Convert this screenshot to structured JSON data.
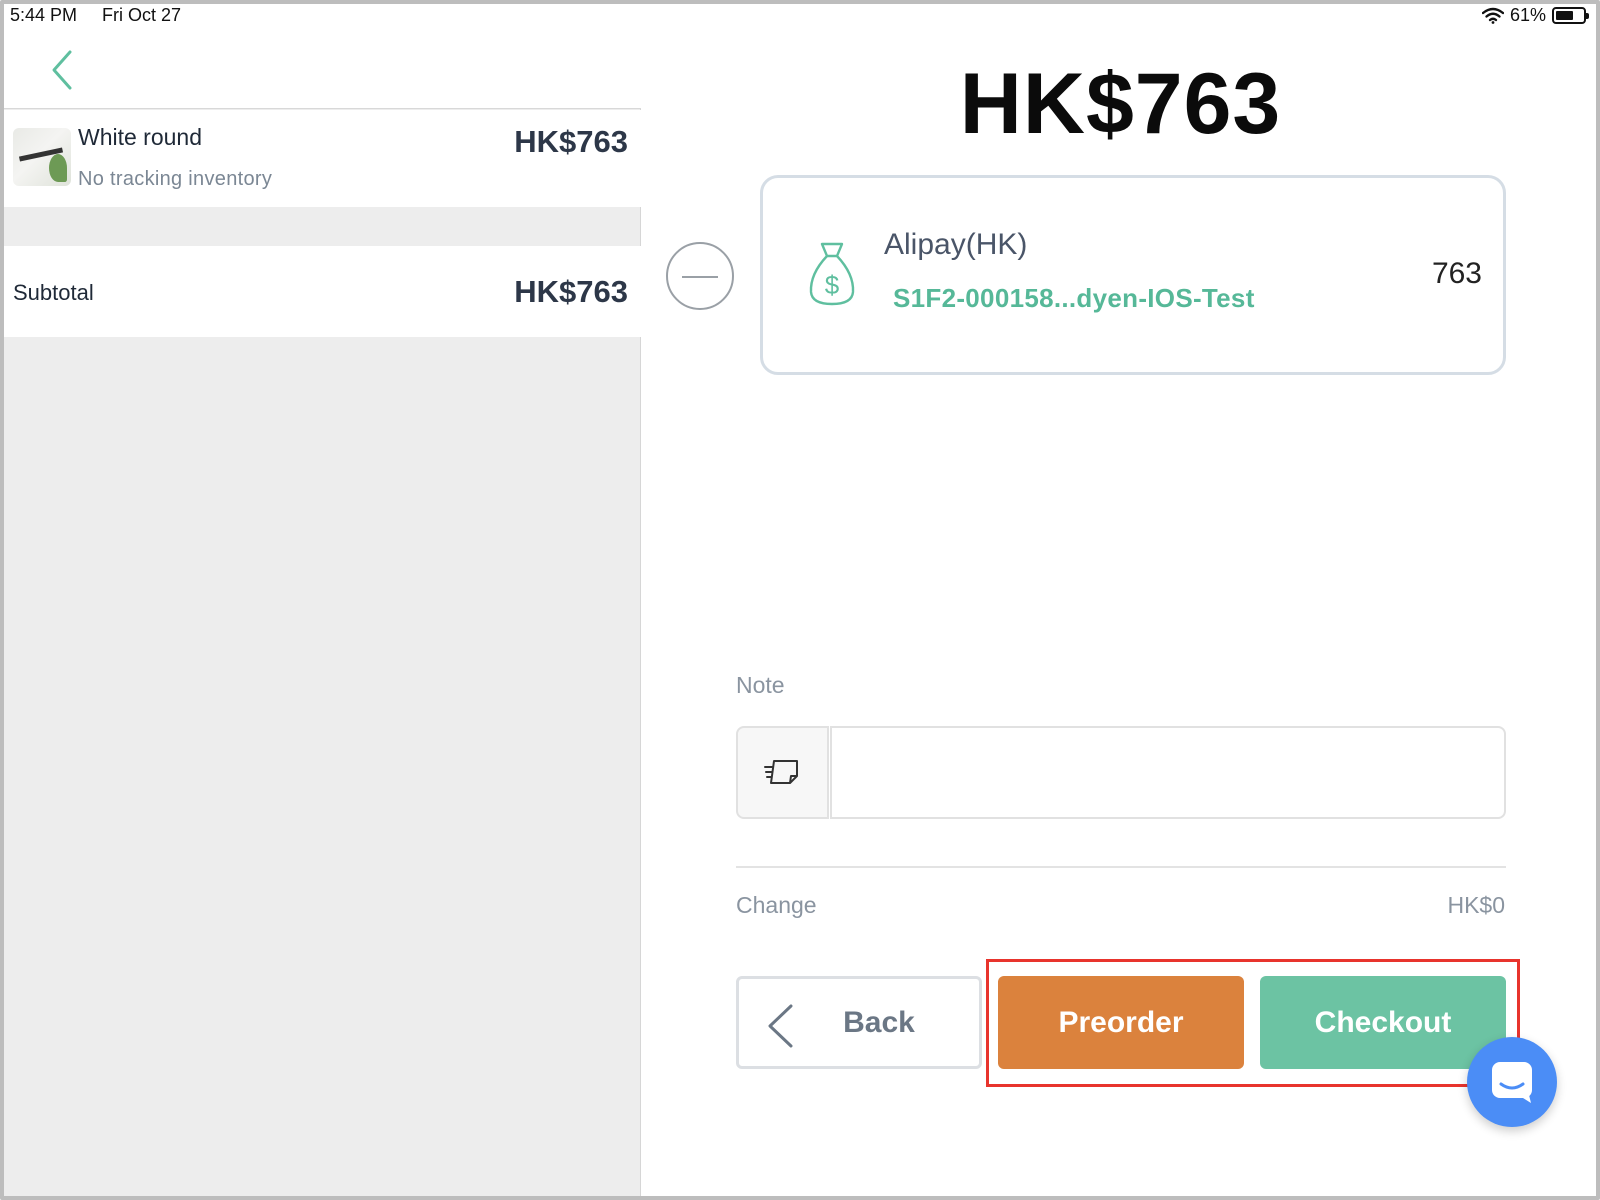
{
  "status_bar": {
    "time": "5:44 PM",
    "date": "Fri Oct 27",
    "battery": "61%"
  },
  "cart": {
    "item": {
      "name": "White round",
      "subtitle": "No tracking inventory",
      "price": "HK$763"
    },
    "subtotal_label": "Subtotal",
    "subtotal_value": "HK$763"
  },
  "payment": {
    "total": "HK$763",
    "method_name": "Alipay(HK)",
    "reference": "S1F2-000158...dyen-IOS-Test",
    "amount": "763"
  },
  "note": {
    "label": "Note",
    "value": ""
  },
  "change": {
    "label": "Change",
    "value": "HK$0"
  },
  "actions": {
    "back": "Back",
    "preorder": "Preorder",
    "checkout": "Checkout"
  },
  "colors": {
    "accent_green": "#6cc3a3",
    "preorder_orange": "#db823d",
    "chat_blue": "#4b8df6",
    "highlight_red": "#e8342d"
  },
  "icons": [
    "back-chevron-icon",
    "remove-circle-icon",
    "money-bag-icon",
    "note-icon",
    "chat-icon",
    "wifi-icon",
    "battery-icon"
  ]
}
